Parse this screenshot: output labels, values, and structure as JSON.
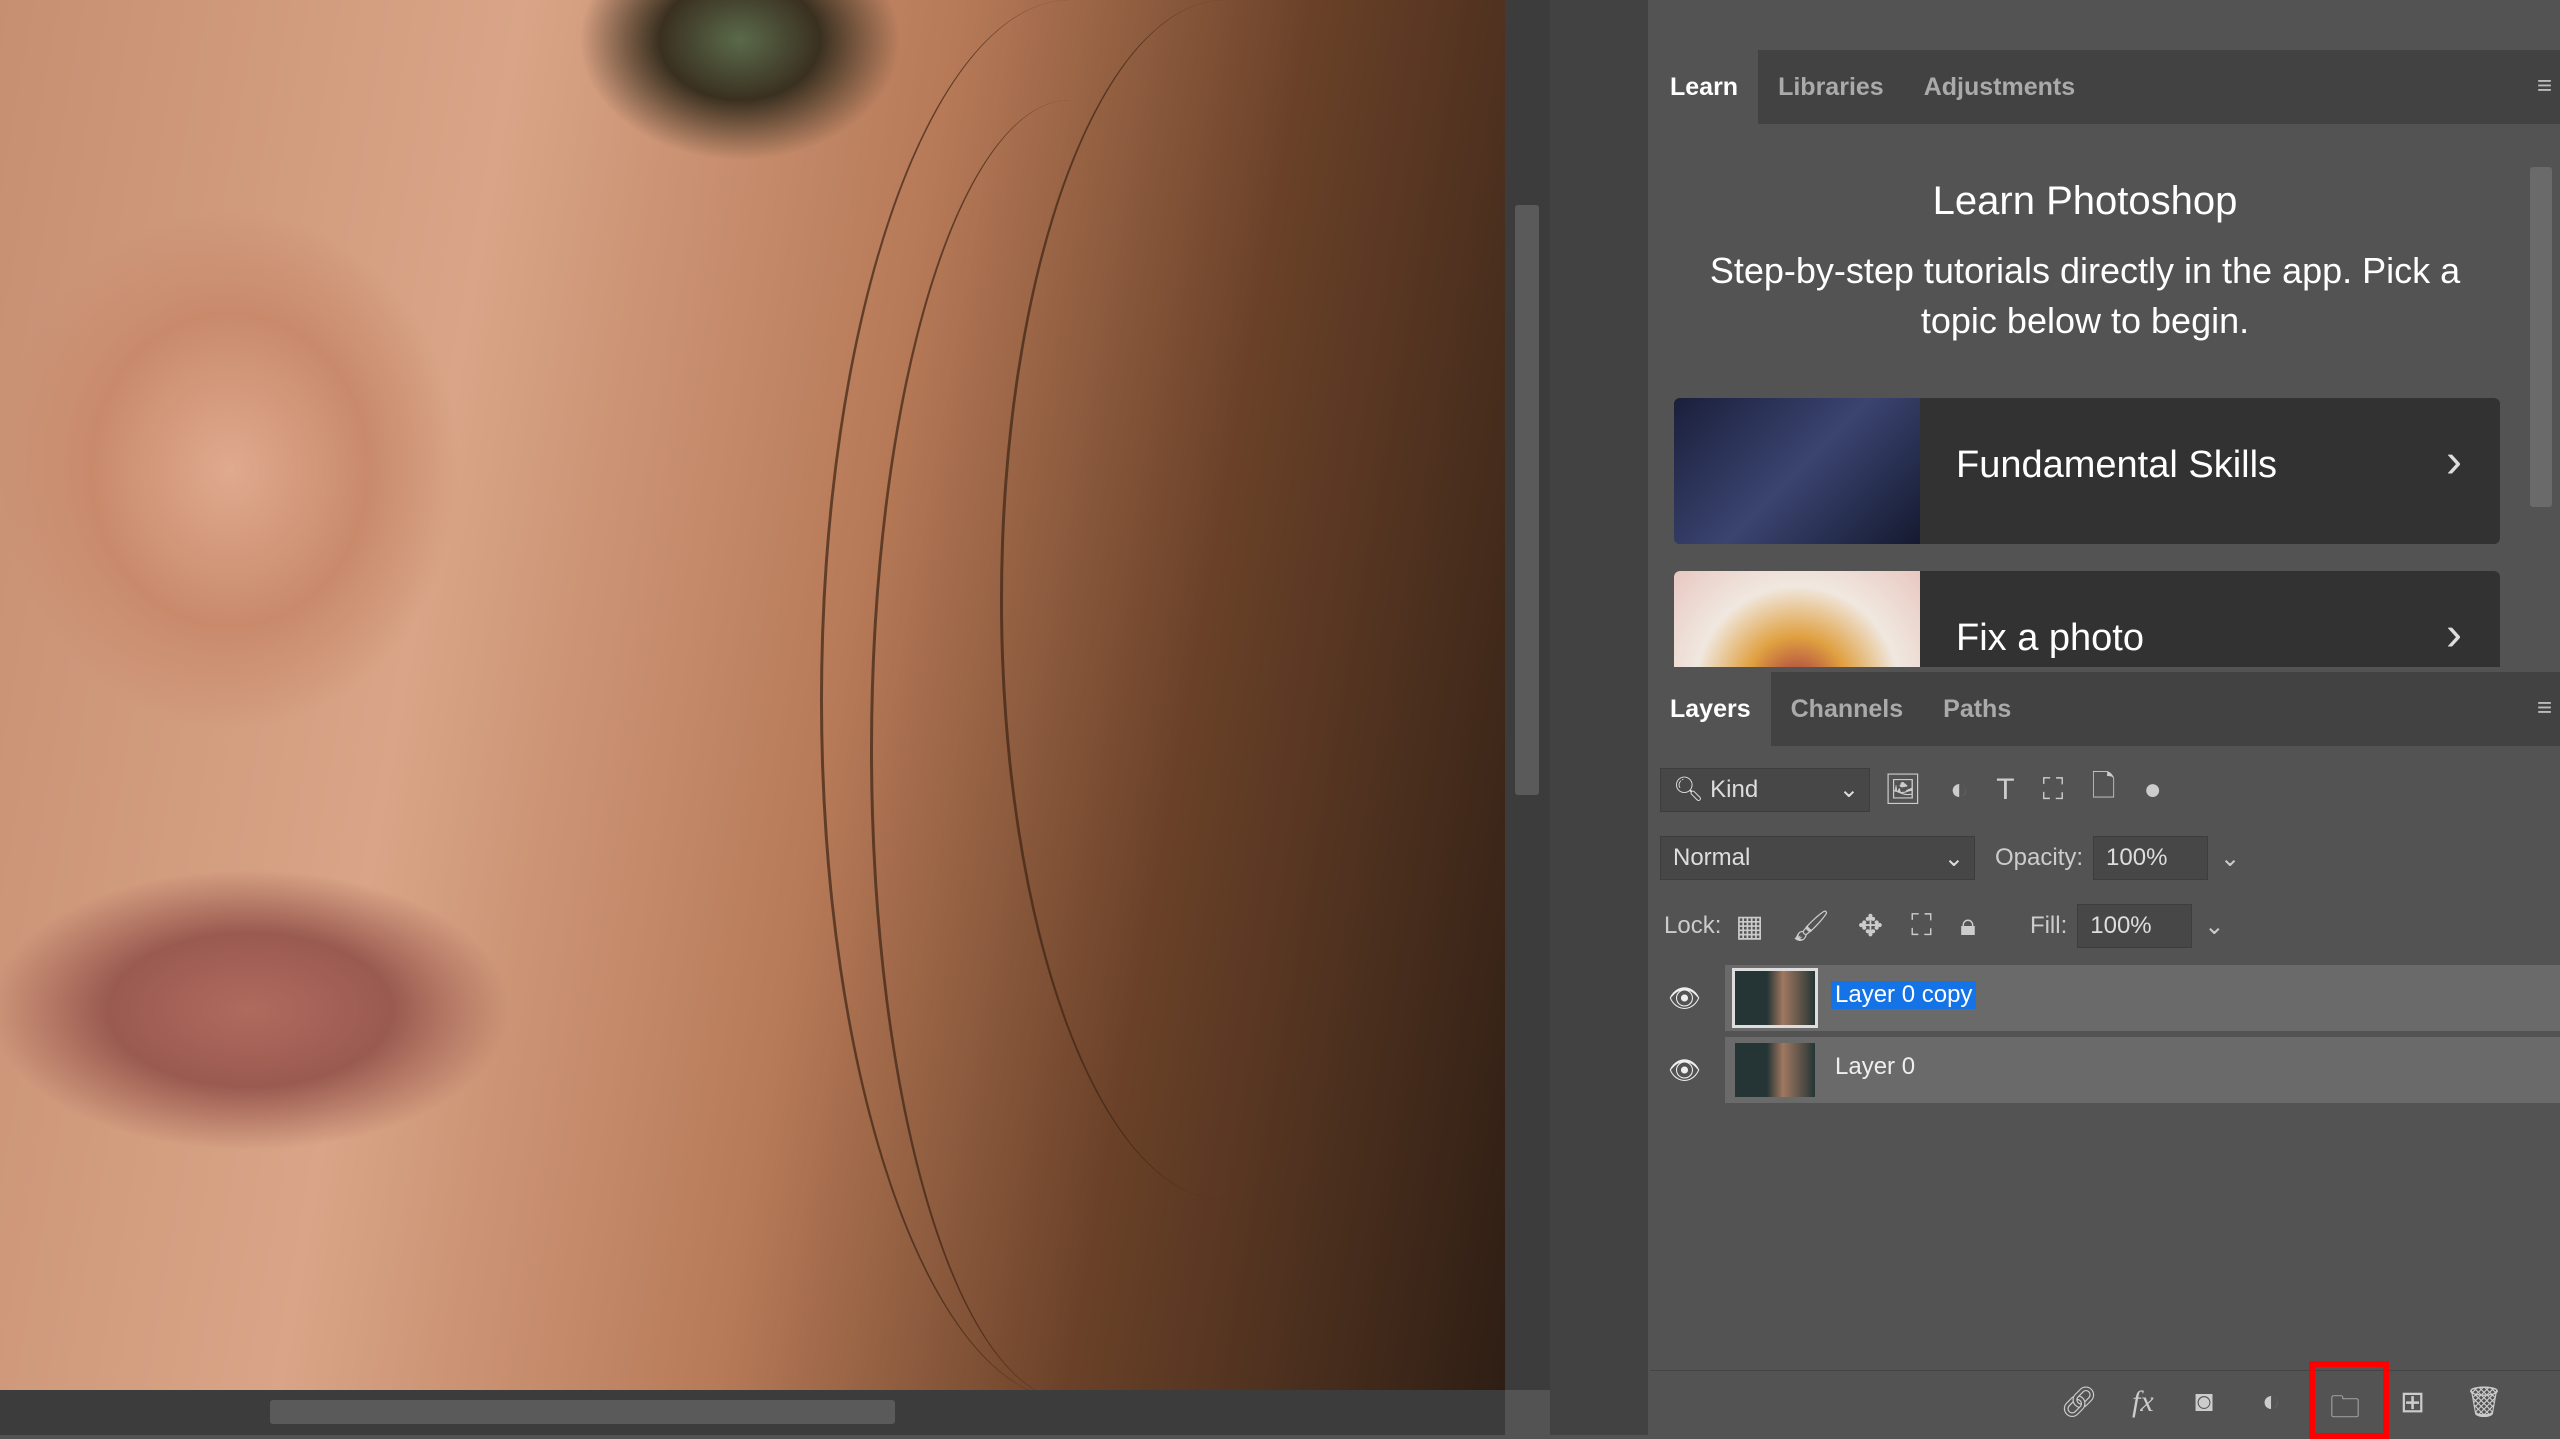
{
  "learn_panel": {
    "tabs": [
      "Learn",
      "Libraries",
      "Adjustments"
    ],
    "title": "Learn Photoshop",
    "subtitle": "Step-by-step tutorials directly in the app. Pick a topic below to begin.",
    "cards": [
      {
        "label": "Fundamental Skills"
      },
      {
        "label": "Fix a photo"
      }
    ]
  },
  "layers_panel": {
    "tabs": [
      "Layers",
      "Channels",
      "Paths"
    ],
    "filter_kind": "Kind",
    "blend_mode": "Normal",
    "opacity_label": "Opacity:",
    "opacity": "100%",
    "lock_label": "Lock:",
    "fill_label": "Fill:",
    "fill": "100%",
    "layers": [
      {
        "name": "Layer 0 copy",
        "selected": true,
        "visible": true
      },
      {
        "name": "Layer 0",
        "selected": false,
        "visible": true
      }
    ]
  },
  "highlight_color": "#ff0000",
  "selection_color": "#1473e6"
}
